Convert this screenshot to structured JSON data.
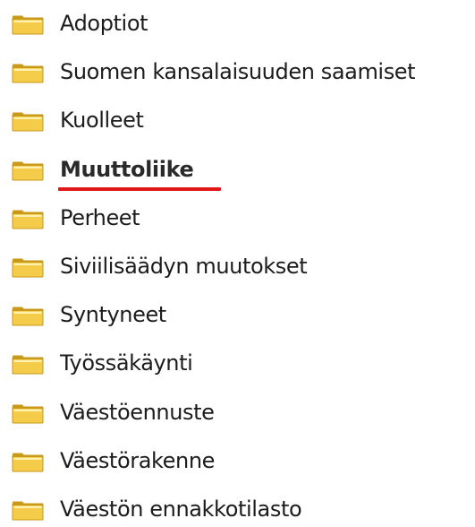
{
  "colors": {
    "folder_fill": "#f4cc4a",
    "folder_dark": "#c99a1a",
    "folder_light": "#fff1b0",
    "active_underline": "#e01818"
  },
  "icon": "folder-icon",
  "folders": [
    {
      "label": "Adoptiot",
      "active": false
    },
    {
      "label": "Suomen kansalaisuuden saamiset",
      "active": false
    },
    {
      "label": "Kuolleet",
      "active": false
    },
    {
      "label": "Muuttoliike",
      "active": true
    },
    {
      "label": "Perheet",
      "active": false
    },
    {
      "label": "Siviilisäädyn muutokset",
      "active": false
    },
    {
      "label": "Syntyneet",
      "active": false
    },
    {
      "label": "Työssäkäynti",
      "active": false
    },
    {
      "label": "Väestöennuste",
      "active": false
    },
    {
      "label": "Väestörakenne",
      "active": false
    },
    {
      "label": "Väestön ennakkotilasto",
      "active": false
    }
  ]
}
